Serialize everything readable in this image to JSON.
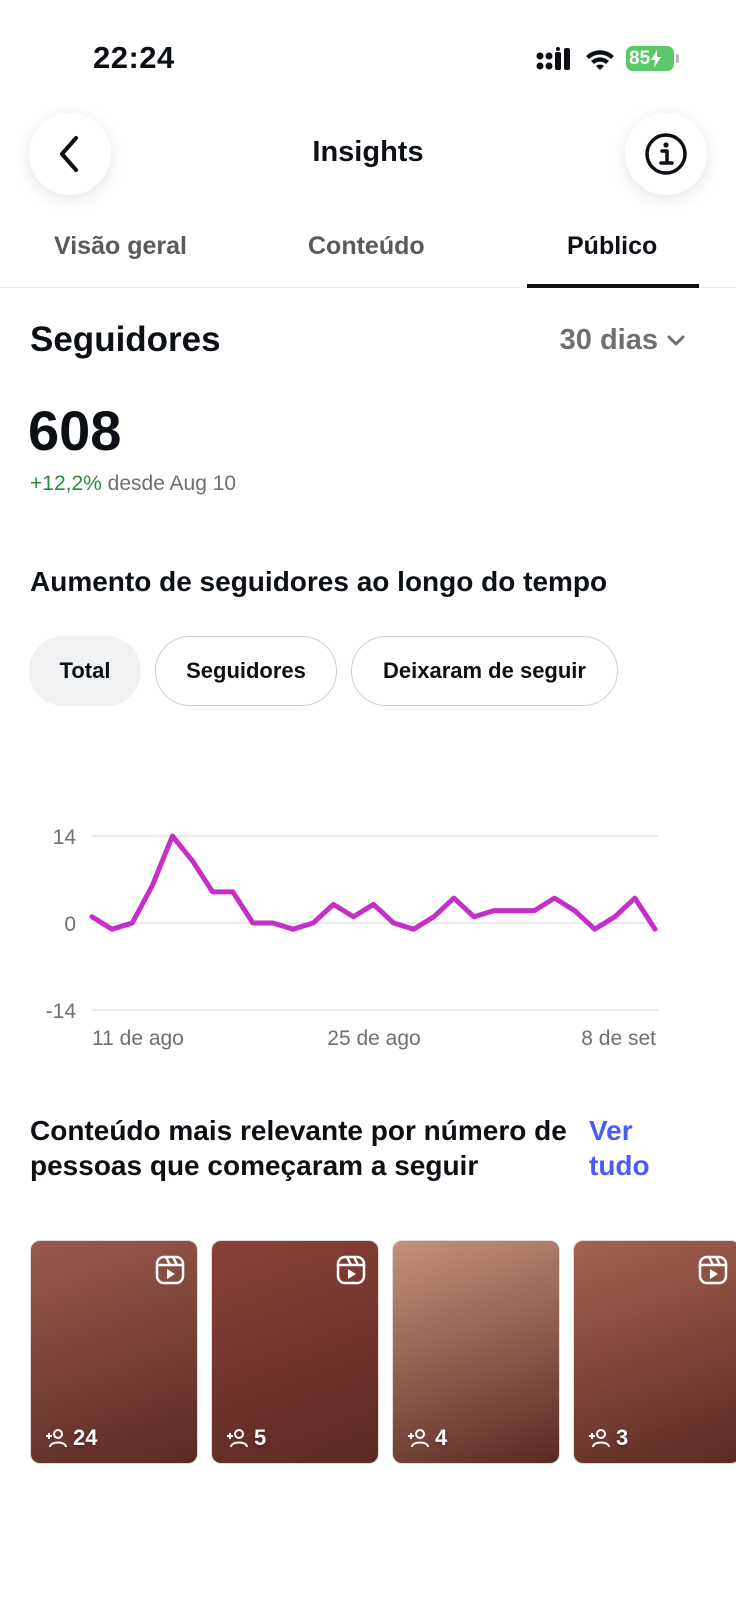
{
  "status": {
    "time": "22:24",
    "battery": "85"
  },
  "header": {
    "title": "Insights"
  },
  "tabs": [
    {
      "label": "Visão geral",
      "active": false
    },
    {
      "label": "Conteúdo",
      "active": false
    },
    {
      "label": "Público",
      "active": true
    }
  ],
  "followers": {
    "title": "Seguidores",
    "period": "30 dias",
    "count": "608",
    "change": "+12,2%",
    "since": "desde Aug 10"
  },
  "chart_section": {
    "title": "Aumento de seguidores ao longo do tempo",
    "filters": [
      {
        "label": "Total",
        "active": true
      },
      {
        "label": "Seguidores",
        "active": false
      },
      {
        "label": "Deixaram de seguir",
        "active": false
      }
    ]
  },
  "chart_data": {
    "type": "line",
    "title": "",
    "xlabel": "",
    "ylabel": "",
    "ylim": [
      -14,
      14
    ],
    "yticks": [
      "14",
      "0",
      "-14"
    ],
    "xticks": [
      "11 de ago",
      "25 de ago",
      "8 de set"
    ],
    "grid": true,
    "series": [
      {
        "values": [
          1,
          -1,
          0,
          6,
          14,
          10,
          5,
          5,
          0,
          0,
          -1,
          0,
          3,
          1,
          3,
          0,
          -1,
          1,
          4,
          1,
          2,
          2,
          2,
          4,
          2,
          -1,
          1,
          4,
          -1
        ]
      }
    ],
    "line_color": "#c42fc9"
  },
  "relevant": {
    "title": "Conteúdo mais relevante por número de pessoas que começaram a seguir",
    "see_all": "Ver tudo",
    "items": [
      {
        "count": "24",
        "bg": "#9a5a4c"
      },
      {
        "count": "5",
        "bg": "#8a4036"
      },
      {
        "count": "4",
        "bg": "#c4927a"
      },
      {
        "count": "3",
        "bg": "#a56250"
      }
    ]
  }
}
